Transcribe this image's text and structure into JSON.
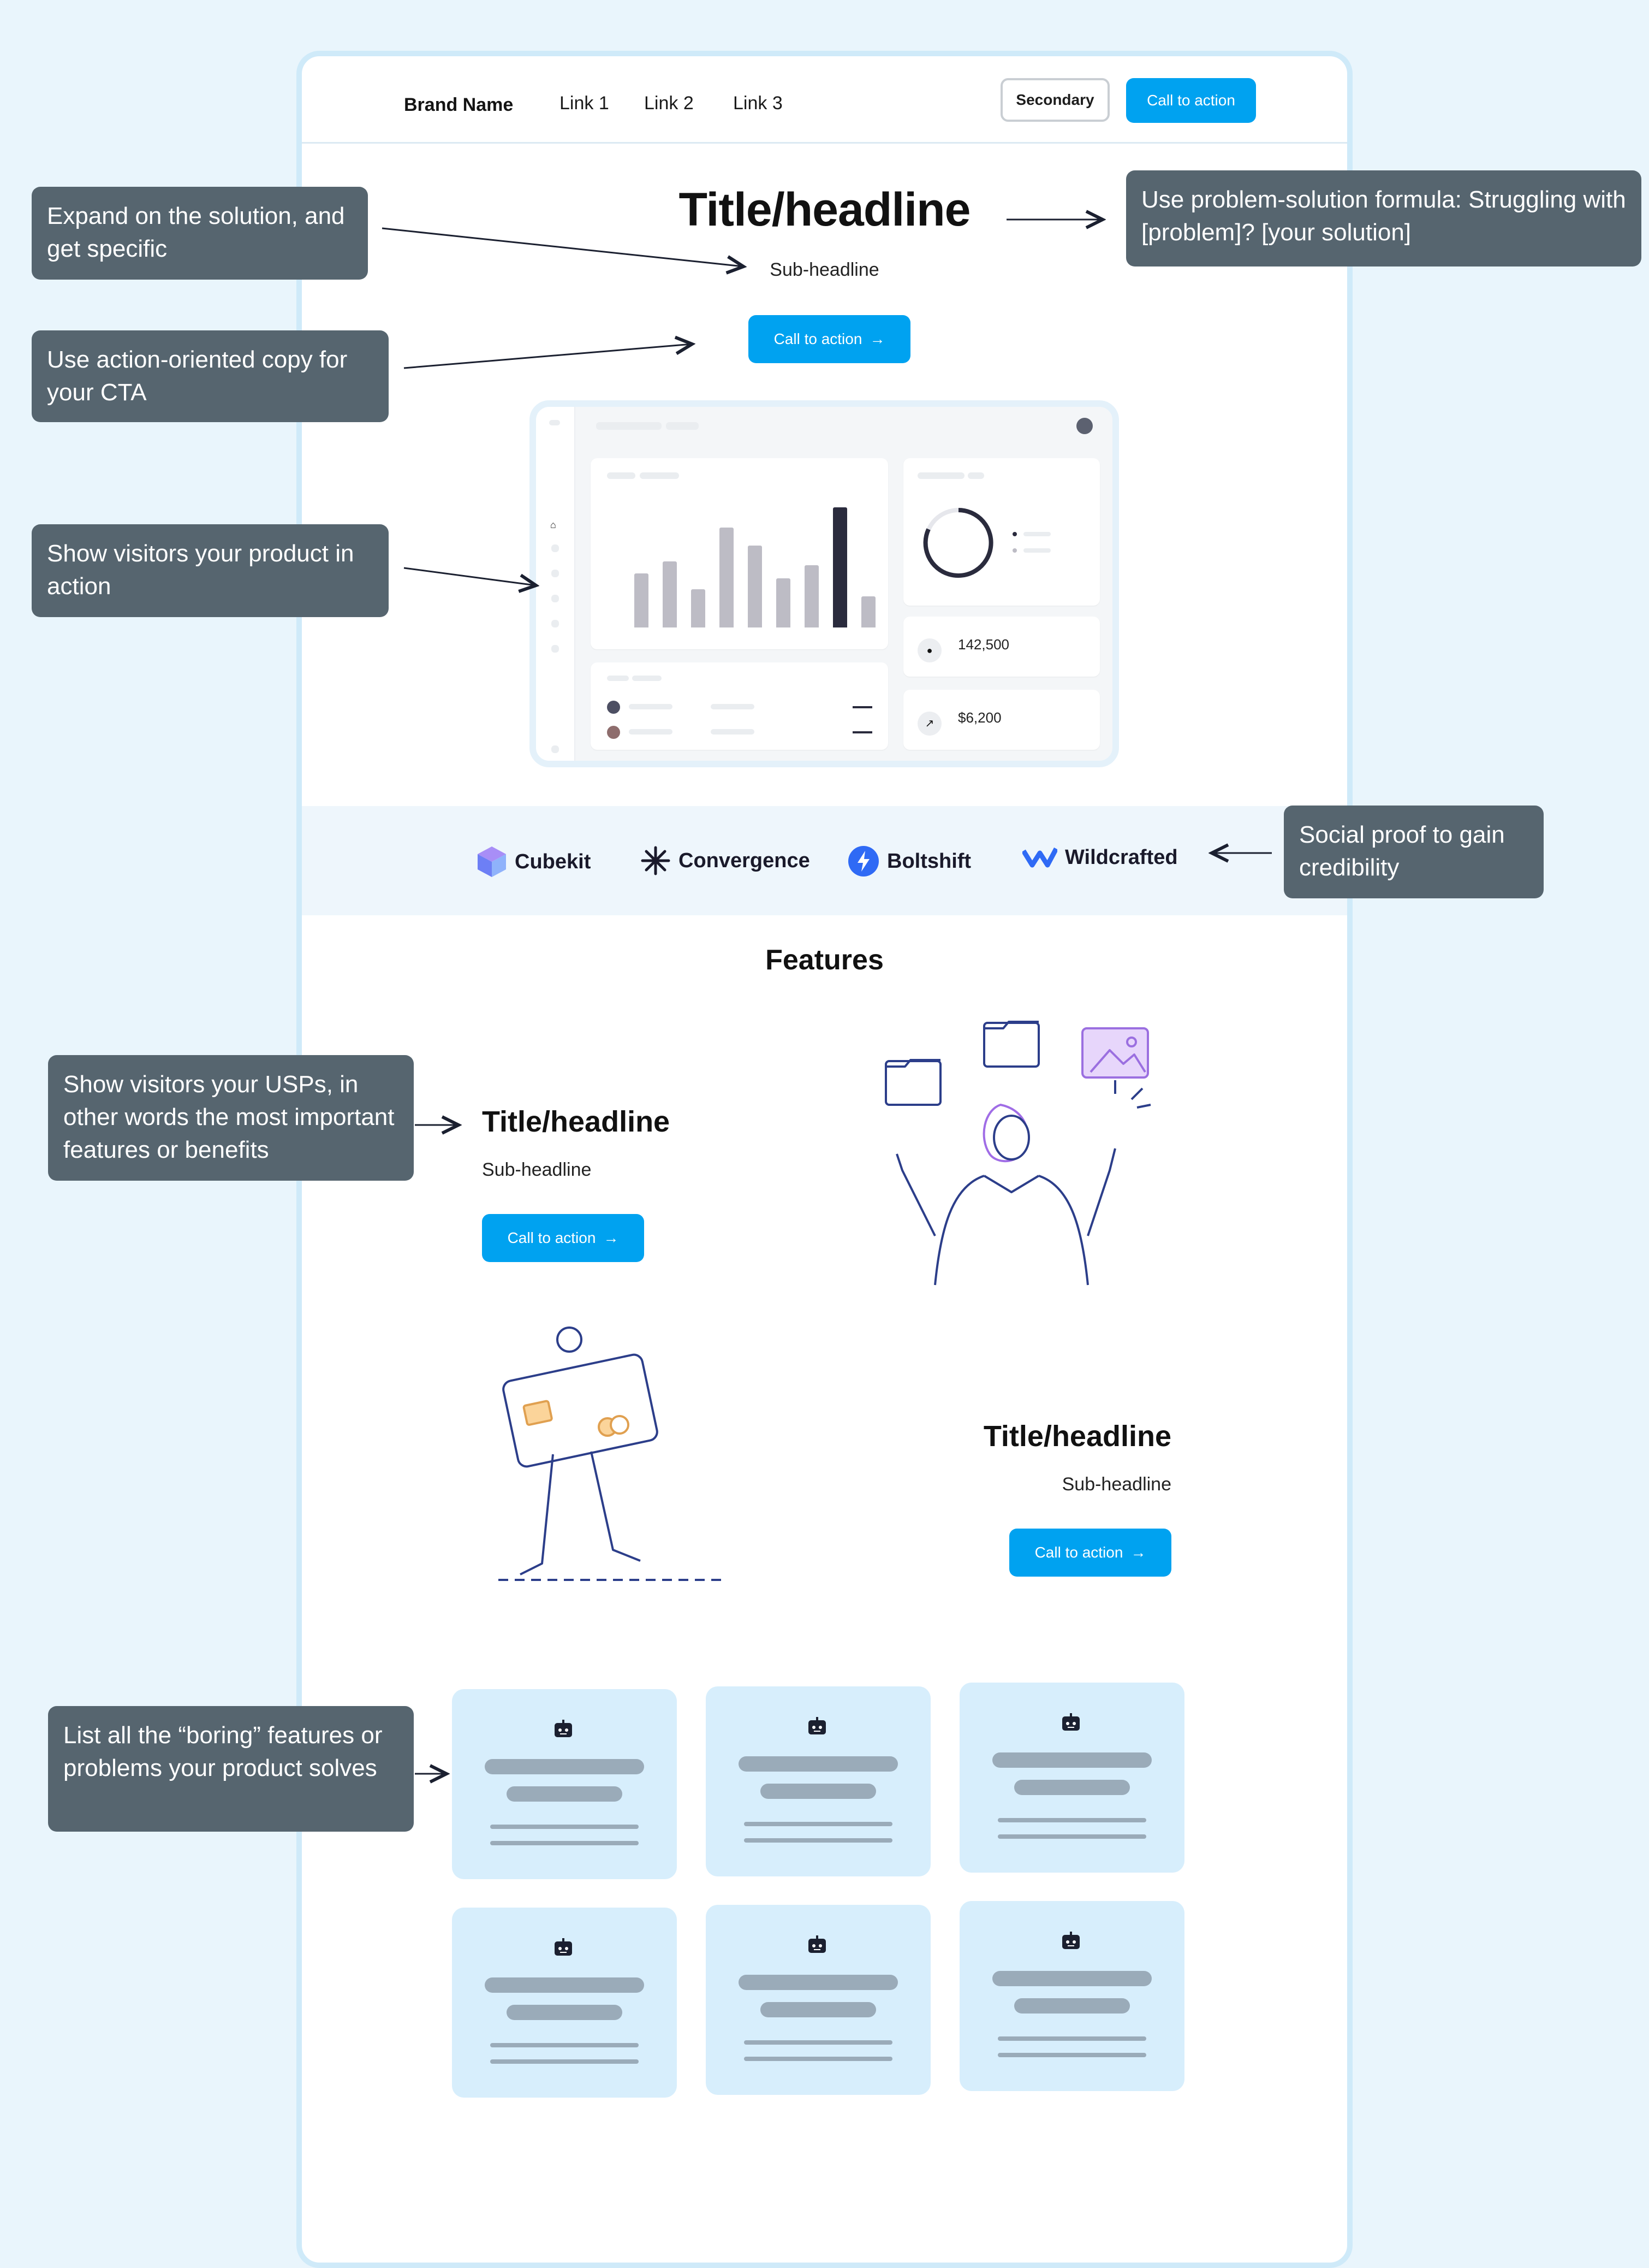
{
  "nav": {
    "brand": "Brand Name",
    "links": [
      "Link 1",
      "Link 2",
      "Link 3"
    ],
    "secondary_label": "Secondary",
    "cta_label": "Call to action"
  },
  "hero": {
    "title": "Title/headline",
    "subtitle": "Sub-headline",
    "cta_label": "Call to action"
  },
  "dashboard": {
    "stat_users": "142,500",
    "stat_revenue": "$6,200",
    "bar_values": [
      0.45,
      0.55,
      0.32,
      0.83,
      0.68,
      0.41,
      0.52,
      1.0,
      0.26
    ],
    "highlight_index": 7
  },
  "logos": [
    "Cubekit",
    "Convergence",
    "Boltshift",
    "Wildcrafted"
  ],
  "features": {
    "heading": "Features",
    "items": [
      {
        "title": "Title/headline",
        "subtitle": "Sub-headline",
        "cta_label": "Call to action"
      },
      {
        "title": "Title/headline",
        "subtitle": "Sub-headline",
        "cta_label": "Call to action"
      }
    ]
  },
  "annotations": {
    "expand": "Expand on the solution, and  get specific",
    "cta_copy": "Use action-oriented copy for your CTA",
    "show_product": "Show visitors your product in action",
    "formula": "Use problem-solution formula: Struggling with [problem]? [your solution]",
    "social_proof": "Social proof to gain credibility",
    "usps": "Show visitors your USPs, in other words the most important features or benefits",
    "boring": "List all the “boring” features or problems your product solves"
  },
  "colors": {
    "primary": "#00a2f0",
    "annotation_bg": "#56656f",
    "page_bg": "#e9f5fc",
    "card_bg": "#d7eefc"
  }
}
